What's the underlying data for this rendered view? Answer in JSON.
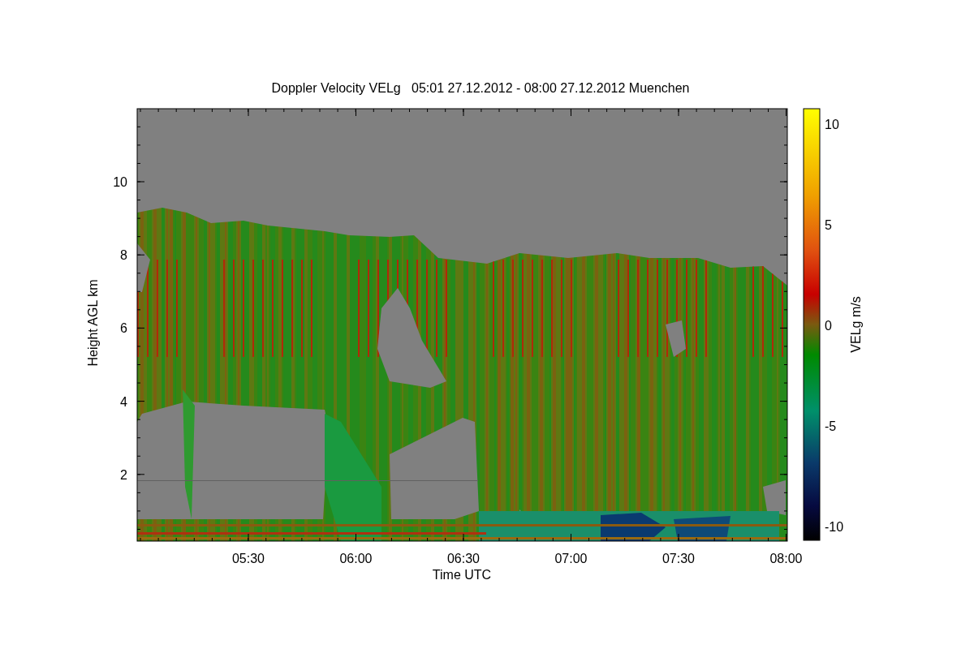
{
  "title": "Doppler Velocity VELg   05:01 27.12.2012 - 08:00 27.12.2012 Muenchen",
  "y_axis": {
    "label": "Height AGL km",
    "ticks": [
      "10",
      "8",
      "6",
      "4",
      "2"
    ]
  },
  "x_axis": {
    "label": "Time UTC",
    "ticks": [
      "05:30",
      "06:00",
      "06:30",
      "07:00",
      "07:30",
      "08:00"
    ]
  },
  "colorbar": {
    "label": "VELg m/s",
    "ticks": [
      "10",
      "5",
      "0",
      "-5",
      "-10"
    ]
  }
}
